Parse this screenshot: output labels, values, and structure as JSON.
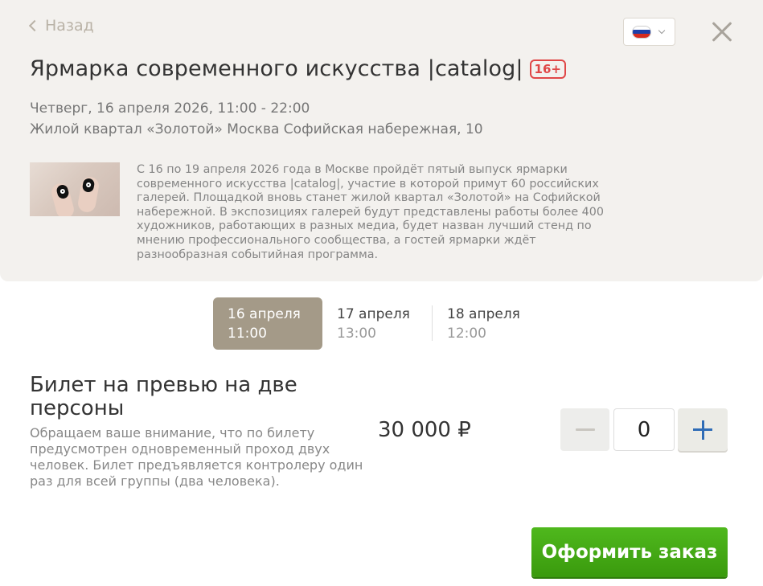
{
  "header": {
    "back_label": "Назад",
    "language": "Русский",
    "event_title": "Ярмарка современного искусства |catalog|",
    "age_rating": "16+",
    "datetime": "Четверг, 16 апреля 2026, 11:00 - 22:00",
    "address": "Жилой квартал «Золотой» Москва Софийская набережная, 10",
    "description": "С 16 по 19 апреля 2026 года в Москве пройдёт пятый выпуск ярмарки современного искусства |catalog|, участие в которой примут 60 российских галерей. Площадкой вновь станет жилой квартал «Золотой» на Софийской набережной. В экспозициях галерей будут представлены работы более 400 художников, работающих в разных медиа, будет назван лучший стенд по мнению профессионального сообщества, а гостей ярмарки ждёт разнообразная событийная программа."
  },
  "dates": [
    {
      "date": "16 апреля",
      "time": "11:00",
      "active": true
    },
    {
      "date": "17 апреля",
      "time": "13:00",
      "active": false
    },
    {
      "date": "18 апреля",
      "time": "12:00",
      "active": false
    }
  ],
  "ticket": {
    "name": "Билет на превью на две персоны",
    "note": "Обращаем ваше внимание, что по билету предусмотрен одновременный проход двух человек. Билет предъявляется контролеру один раз для всей группы (два человека).",
    "price": "30 000 ₽",
    "quantity": "0"
  },
  "order_button": "Оформить заказ",
  "colors": {
    "header_bg": "#f3f1ee",
    "active_date": "#a49a88",
    "order_green": "#44a915",
    "age_red": "#e04747",
    "plus_blue": "#2f6cb6"
  }
}
